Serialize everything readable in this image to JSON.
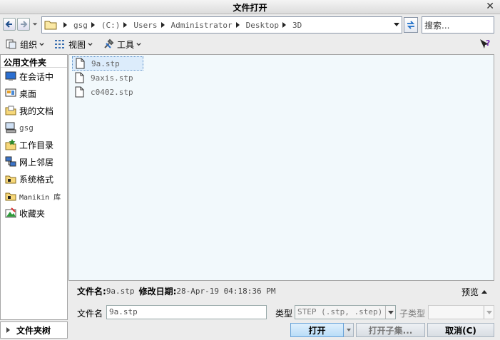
{
  "window": {
    "title": "文件打开"
  },
  "address": {
    "segments": [
      "gsg",
      "(C:)",
      "Users",
      "Administrator",
      "Desktop",
      "3D"
    ],
    "search_placeholder": "搜索..."
  },
  "toolbar": {
    "organize": "组织",
    "view": "视图",
    "tools": "工具"
  },
  "sidebar": {
    "header": "公用文件夹",
    "items": [
      {
        "label": "在会话中",
        "icon": "monitor-icon"
      },
      {
        "label": "桌面",
        "icon": "desktop-icon"
      },
      {
        "label": "我的文档",
        "icon": "my-documents-icon"
      },
      {
        "label": "gsg",
        "icon": "computer-icon"
      },
      {
        "label": "工作目录",
        "icon": "star-folder-icon"
      },
      {
        "label": "网上邻居",
        "icon": "network-icon"
      },
      {
        "label": "系统格式",
        "icon": "folder-icon"
      },
      {
        "label": "Manikin 库",
        "icon": "folder-icon"
      },
      {
        "label": "收藏夹",
        "icon": "favorites-icon"
      }
    ]
  },
  "files": [
    {
      "name": "9a.stp",
      "selected": true
    },
    {
      "name": "9axis.stp",
      "selected": false
    },
    {
      "name": "c0402.stp",
      "selected": false
    }
  ],
  "info": {
    "filename_label": "文件名:",
    "filename_value": "9a.stp",
    "modified_label": "修改日期:",
    "modified_value": "28-Apr-19 04:18:36 PM",
    "preview_label": "预览"
  },
  "form": {
    "filename_label": "文件名",
    "filename_value": "9a.stp",
    "type_label": "类型",
    "type_value": "STEP (.stp, .step)",
    "subtype_label": "子类型",
    "subtype_value": ""
  },
  "footer": {
    "folder_tree": "文件夹树",
    "open": "打开",
    "open_sub": "打开子集...",
    "cancel": "取消(C)"
  },
  "colors": {
    "accent": "#1e6fc8",
    "file_pane_bg": "#f2f9fc",
    "selection": "#dcecfb"
  }
}
